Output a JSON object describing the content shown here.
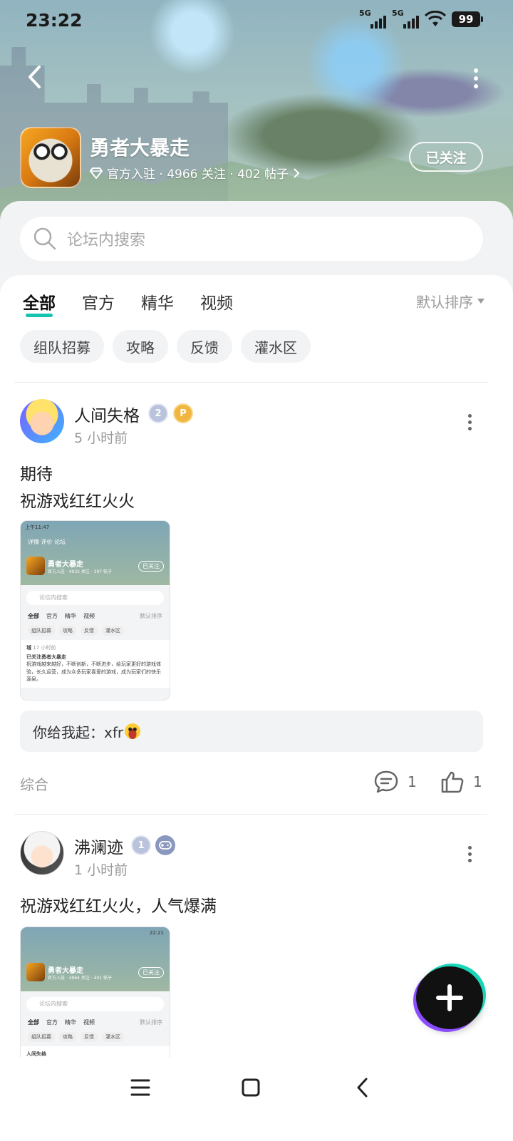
{
  "status_bar": {
    "time": "23:22",
    "signal1": "5G",
    "signal2": "5G",
    "battery": "99"
  },
  "header": {
    "game_title": "勇者大暴走",
    "meta": "官方入驻 · 4966 关注 · 402 帖子",
    "follow_label": "已关注"
  },
  "search": {
    "placeholder": "论坛内搜索"
  },
  "tabs": [
    {
      "label": "全部",
      "active": true
    },
    {
      "label": "官方",
      "active": false
    },
    {
      "label": "精华",
      "active": false
    },
    {
      "label": "视频",
      "active": false
    }
  ],
  "sort_label": "默认排序",
  "chips": [
    "组队招募",
    "攻略",
    "反馈",
    "灌水区"
  ],
  "posts": [
    {
      "user": "人间失格",
      "level": "2",
      "time": "5 小时前",
      "title_line1": "期待",
      "title_line2": "祝游戏红红火火",
      "thumb": {
        "time": "上午11:47",
        "nav": "详情  评价  论坛",
        "game": "勇者大暴走",
        "meta": "官方入驻 · 4932 关注 · 397 帖子",
        "follow": "已关注",
        "search": "论坛内搜索",
        "tabs": [
          "全部",
          "官方",
          "精华",
          "视频"
        ],
        "sort": "默认排序",
        "chips": [
          "组队招募",
          "攻略",
          "反馈",
          "灌水区"
        ],
        "user": "城",
        "user_time": "17 小时前",
        "post_title": "已关注勇者大暴走",
        "post_body": "祝游戏越来越好，不断创新，不断进步，给玩家更好的游戏体验，长久运营，成为众多玩家喜爱的游戏，成为玩家们的快乐源泉。"
      },
      "comment_prefix": "你给我起：xfr",
      "category": "综合",
      "comments": "1",
      "likes": "1"
    },
    {
      "user": "沸澜迹",
      "level": "1",
      "time": "1 小时前",
      "title_line1": "祝游戏红红火火，人气爆满",
      "thumb": {
        "time": "22:21",
        "game": "勇者大暴走",
        "meta": "官方入驻 · 4964 关注 · 401 帖子",
        "follow": "已关注",
        "search": "论坛内搜索",
        "tabs": [
          "全部",
          "官方",
          "精华",
          "视频"
        ],
        "sort": "默认排序",
        "chips": [
          "组队招募",
          "攻略",
          "反馈",
          "灌水区"
        ],
        "user": "人间失格"
      }
    }
  ],
  "colors": {
    "accent_teal": "#16c2b0",
    "fab_purple": "#8a4dff",
    "fab_teal": "#19d4b6"
  }
}
